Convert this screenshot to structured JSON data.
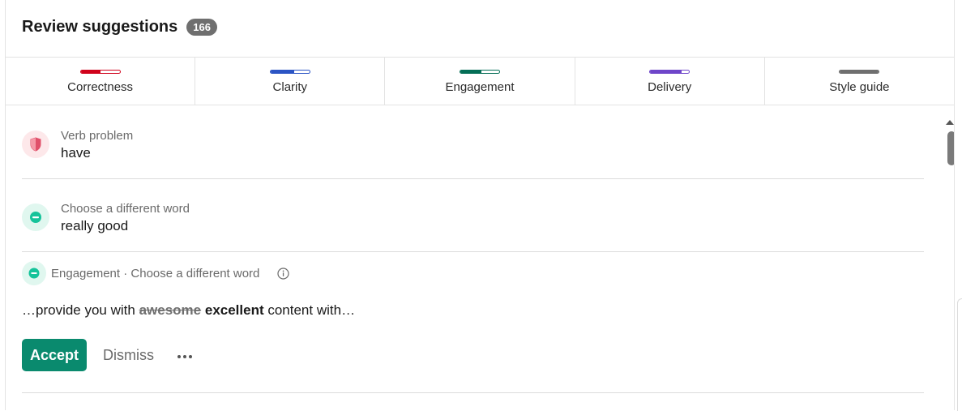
{
  "header": {
    "title": "Review suggestions",
    "count": "166"
  },
  "tabs": [
    {
      "label": "Correctness",
      "color": "#d0021b",
      "progress": 0.5
    },
    {
      "label": "Clarity",
      "color": "#2b54c4",
      "progress": 0.6
    },
    {
      "label": "Engagement",
      "color": "#046e56",
      "progress": 0.55
    },
    {
      "label": "Delivery",
      "color": "#6e45c9",
      "progress": 0.8
    },
    {
      "label": "Style guide",
      "color": "#6f6f6f",
      "progress": 1.0
    }
  ],
  "suggestions": [
    {
      "category": "Verb problem",
      "word": "have",
      "icon": "shield-icon",
      "color": "#d0021b"
    },
    {
      "category": "Choose a different word",
      "word": "really good",
      "icon": "engagement-icon",
      "color": "#15c39a"
    }
  ],
  "expanded": {
    "title": "Engagement · Choose a different word",
    "sentence_before": "…provide you with ",
    "removed": "awesome",
    "added": "excellent",
    "sentence_after": " content with…",
    "accept_label": "Accept",
    "dismiss_label": "Dismiss",
    "icon": "engagement-icon",
    "info_icon": "info-icon",
    "more_icon": "more-dots-icon"
  },
  "colors": {
    "accent": "#0a8a6e"
  }
}
